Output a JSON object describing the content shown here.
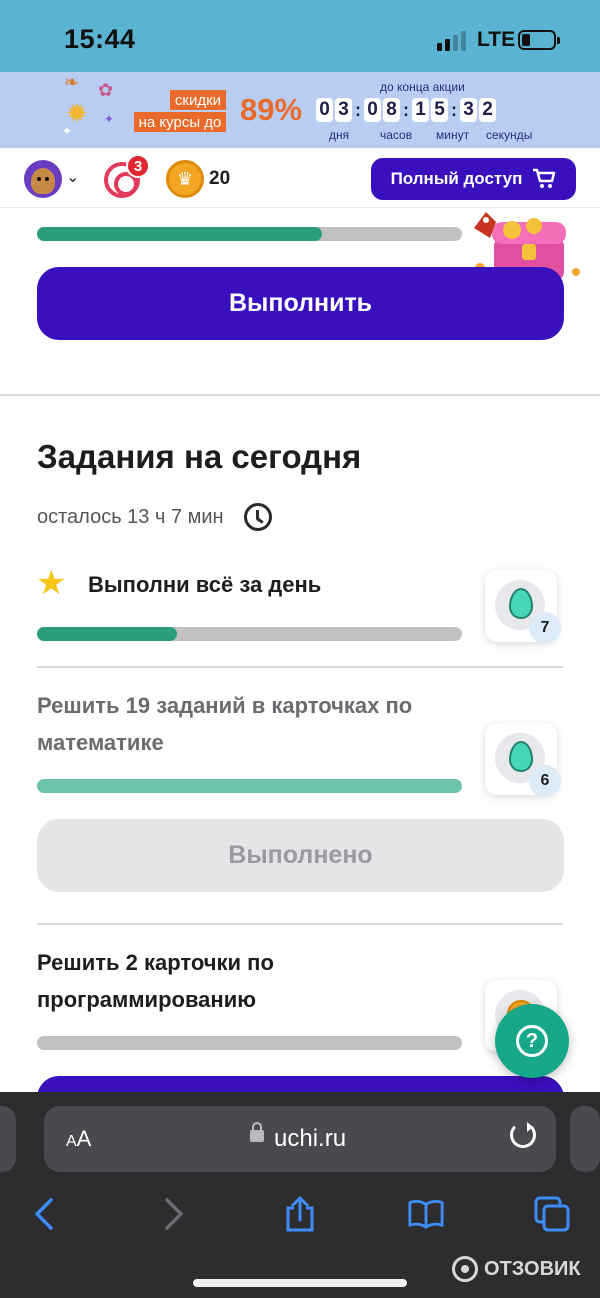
{
  "status_bar": {
    "time": "15:44",
    "network": "LTE"
  },
  "promo": {
    "label_line1": "скидки",
    "label_line2": "на курсы до",
    "percent": "89%",
    "countdown_title": "до конца акции",
    "digits": [
      "0",
      "3",
      "0",
      "8",
      "1",
      "5",
      "3",
      "2"
    ],
    "units": [
      "дня",
      "часов",
      "минут",
      "секунды"
    ]
  },
  "header": {
    "target_badge": "3",
    "coins": "20",
    "full_access_label": "Полный доступ"
  },
  "top_card": {
    "progress_percent": 67,
    "button_label": "Выполнить"
  },
  "tasks_section": {
    "title": "Задания на сегодня",
    "remaining": "осталось 13 ч 7 мин",
    "tasks": [
      {
        "title": "Выполни всё за день",
        "progress_percent": 33,
        "reward_count": "7"
      },
      {
        "title_line1": "Решить 19 заданий в карточках по",
        "title_line2": "математике",
        "progress_percent": 100,
        "reward_count": "6",
        "button_label": "Выполнено"
      },
      {
        "title_line1": "Решить 2 карточки по",
        "title_line2": "программированию",
        "progress_percent": 0
      }
    ]
  },
  "help_button": {
    "label": "?"
  },
  "browser": {
    "text_size_small": "A",
    "text_size_large": "A",
    "url": "uchi.ru"
  },
  "watermark": {
    "text": "ОТЗОВИК"
  },
  "colors": {
    "brand": "#3a0fbd",
    "progress": "#2a9d7c",
    "progress_light": "#6cc4ac",
    "accent": "#ea6a2a"
  }
}
